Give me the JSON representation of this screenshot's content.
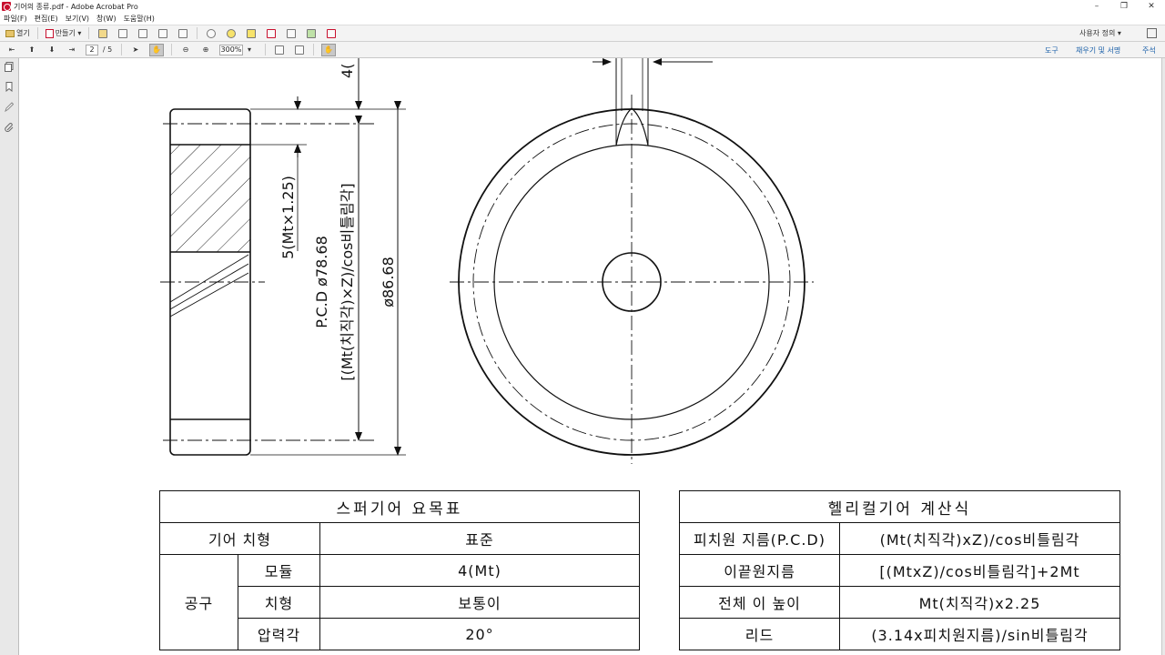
{
  "window": {
    "title": "기어의 종류.pdf - Adobe Acrobat Pro",
    "minimize_glyph": "–",
    "restore_glyph": "❐",
    "close_glyph": "✕"
  },
  "menu": [
    "파일(F)",
    "편집(E)",
    "보기(V)",
    "창(W)",
    "도움말(H)"
  ],
  "toolbar1": {
    "open_label": "열기",
    "create_label": "만들기 ▾",
    "customize_label": "사용자 정의 ▾"
  },
  "toolbar2": {
    "current_page": "2",
    "page_total": "/ 5",
    "zoom": "300%",
    "zoom_arrow": "▾",
    "tools_label": "도구",
    "fill_sign_label": "채우기 및 서명",
    "comment_label": "주석"
  },
  "drawing": {
    "dim_tooth_height": "5(Mt×1.25)",
    "dim_pcd": "P.C.D  ø78.68",
    "dim_pcd_formula": "[(Mt(치직각)×Z)/cos비틀림각]",
    "dim_outer": "ø86.68",
    "dim_top_cut": "4("
  },
  "spur_table": {
    "title": "스퍼기어 요목표",
    "rows": [
      {
        "label": "기어 치형",
        "value": "표준"
      },
      {
        "group": "공구",
        "sub": "모듈",
        "value": "4(Mt)"
      },
      {
        "sub": "치형",
        "value": "보통이"
      },
      {
        "sub": "압력각",
        "value": "20°"
      }
    ]
  },
  "helical_table": {
    "title": "헬리컬기어 계산식",
    "rows": [
      {
        "label": "피치원 지름(P.C.D)",
        "value": "(Mt(치직각)xZ)/cos비틀림각"
      },
      {
        "label": "이끝원지름",
        "value": "[(MtxZ)/cos비틀림각]+2Mt"
      },
      {
        "label": "전체 이 높이",
        "value": "Mt(치직각)x2.25"
      },
      {
        "label": "리드",
        "value": "(3.14x피치원지름)/sin비틀림각"
      }
    ]
  },
  "colors": {
    "toolbar_bg": "#f3f3f3",
    "link_blue": "#1a5fa8",
    "app_red": "#c8102e"
  }
}
